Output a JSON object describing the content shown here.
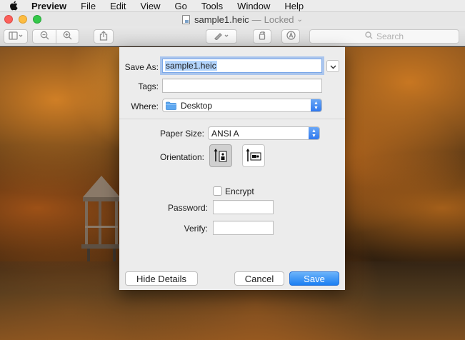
{
  "menubar": {
    "app_name": "Preview",
    "items": [
      "File",
      "Edit",
      "View",
      "Go",
      "Tools",
      "Window",
      "Help"
    ]
  },
  "window": {
    "filename": "sample1.heic",
    "separator": "—",
    "status": "Locked",
    "status_chevron": "⌄"
  },
  "toolbar": {
    "search_placeholder": "Search"
  },
  "dialog": {
    "save_as_label": "Save As:",
    "save_as_value": "sample1.heic",
    "tags_label": "Tags:",
    "tags_value": "",
    "where_label": "Where:",
    "where_value": "Desktop",
    "paper_size_label": "Paper Size:",
    "paper_size_value": "ANSI A",
    "orientation_label": "Orientation:",
    "encrypt_label": "Encrypt",
    "encrypt_checked": false,
    "password_label": "Password:",
    "password_value": "",
    "verify_label": "Verify:",
    "verify_value": "",
    "hide_details_label": "Hide Details",
    "cancel_label": "Cancel",
    "save_label": "Save"
  },
  "colors": {
    "accent": "#2f79ef",
    "close": "#fc605b",
    "minimize": "#fdbc40",
    "zoom": "#34c84a"
  }
}
